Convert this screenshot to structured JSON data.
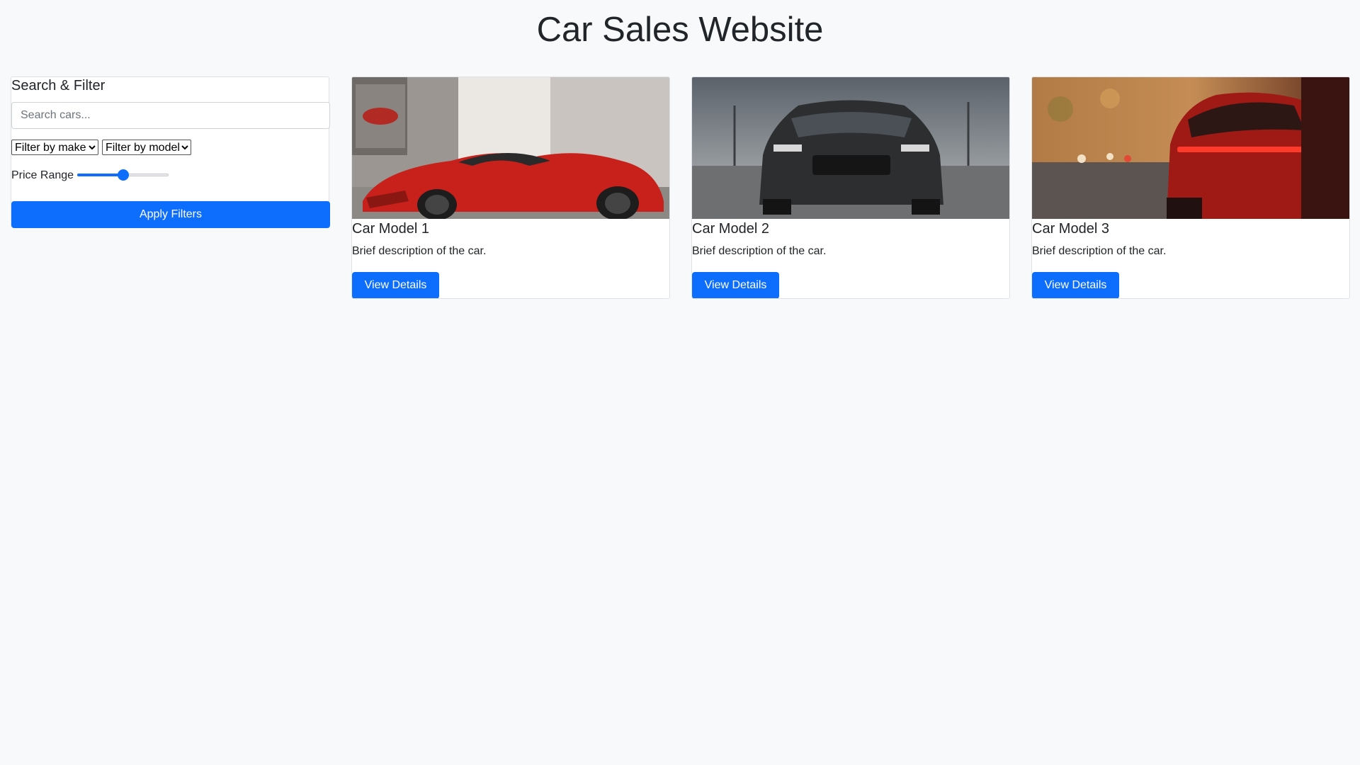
{
  "page": {
    "title": "Car Sales Website"
  },
  "filters": {
    "heading": "Search & Filter",
    "search_placeholder": "Search cars...",
    "make_select": "Filter by make",
    "model_select": "Filter by model",
    "price_label": "Price Range",
    "price_value": 0.5,
    "apply_label": "Apply Filters"
  },
  "cars": [
    {
      "title": "Car Model 1",
      "description": "Brief description of the car.",
      "button": "View Details",
      "image": "red-sports-car-photo"
    },
    {
      "title": "Car Model 2",
      "description": "Brief description of the car.",
      "button": "View Details",
      "image": "black-muscle-car-photo"
    },
    {
      "title": "Car Model 3",
      "description": "Brief description of the car.",
      "button": "View Details",
      "image": "red-sedan-rear-photo"
    }
  ],
  "colors": {
    "accent": "#0d6efd",
    "background": "#f8f9fa",
    "text": "#212529"
  }
}
